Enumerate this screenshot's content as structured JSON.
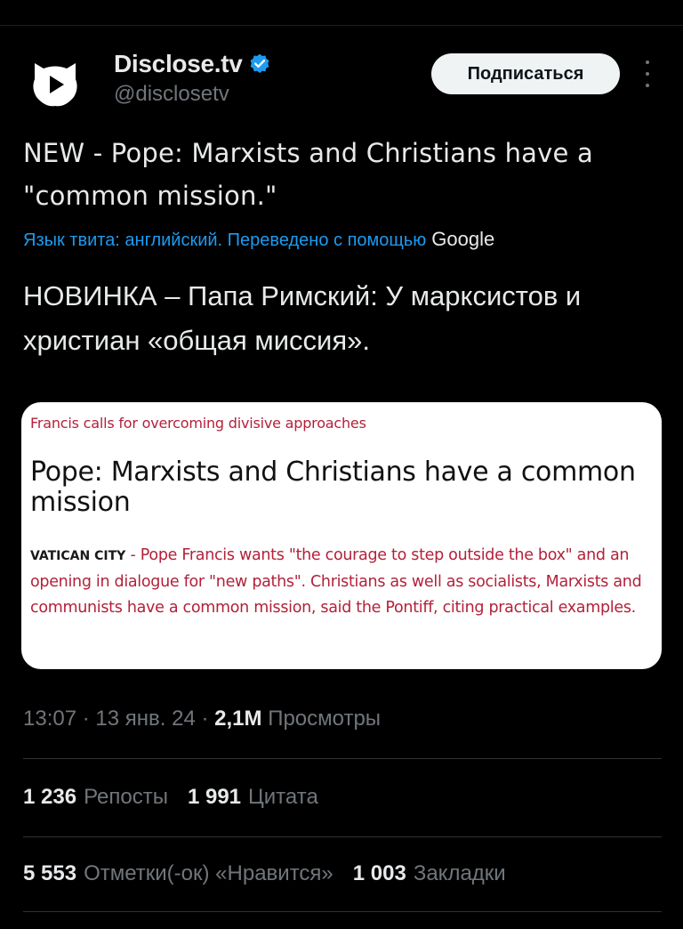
{
  "author": {
    "display_name": "Disclose.tv",
    "handle": "@disclosetv",
    "verified": true,
    "avatar_icon": "disclose-logo-icon",
    "verified_color": "#1d9bf0"
  },
  "header": {
    "subscribe_label": "Подписаться",
    "more_icon": "more-vertical-icon"
  },
  "tweet": {
    "text": "NEW - Pope: Marxists and Christians have a \"common mission.\"",
    "translation_label": "Язык твита: английский. Переведено с помощью",
    "translation_provider": "Google",
    "translated_text": "НОВИНКА – Папа Римский: У марксистов и христиан «общая миссия»."
  },
  "media": {
    "kicker": "Francis calls for overcoming divisive approaches",
    "headline": "Pope: Marxists and Christians have a common mission",
    "dateline": "VATICAN CITY",
    "body": " - Pope Francis wants \"the courage to step outside the box\" and an opening in dialogue for \"new paths\". Christians as well as socialists, Marxists and communists have a common mission, said the Pontiff, citing practical examples.",
    "accent_color": "#b3213a"
  },
  "meta": {
    "time": "13:07",
    "date": "13 янв. 24",
    "views_count": "2,1M",
    "views_label": "Просмотры"
  },
  "stats": {
    "reposts_count": "1 236",
    "reposts_label": "Репосты",
    "quotes_count": "1 991",
    "quotes_label": "Цитата",
    "likes_count": "5 553",
    "likes_label": "Отметки(-ок) «Нравится»",
    "bookmarks_count": "1 003",
    "bookmarks_label": "Закладки"
  },
  "colors": {
    "background": "#000000",
    "text": "#e7e9ea",
    "secondary_text": "#71767b",
    "link": "#1d9bf0",
    "divider": "#2f3336"
  }
}
